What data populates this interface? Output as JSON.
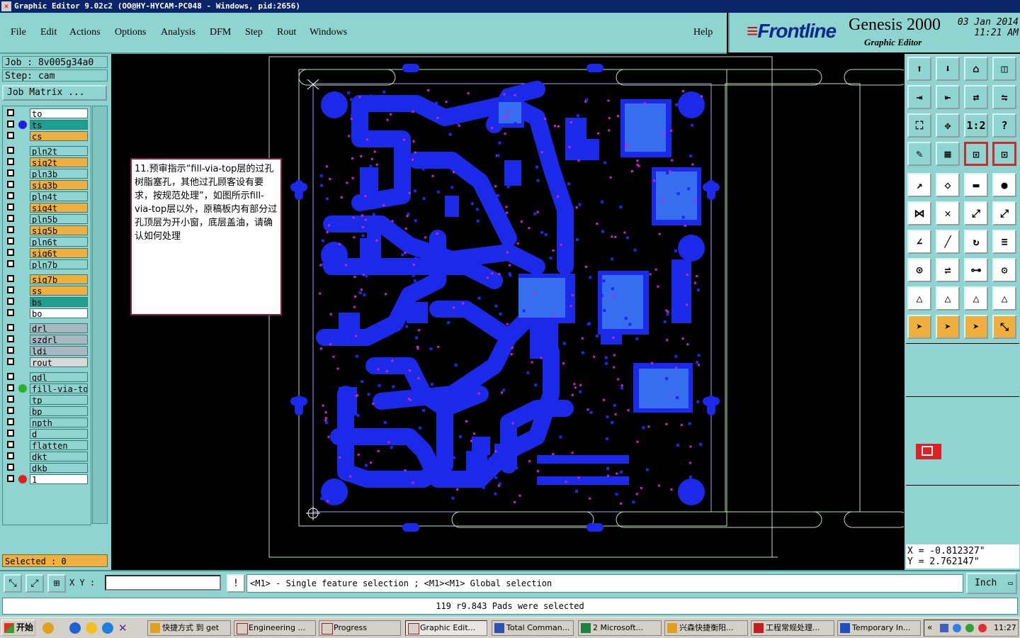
{
  "window": {
    "title": "Graphic Editor 9.02c2 (OO@HY-HYCAM-PC048 - Windows, pid:2656)"
  },
  "menu": {
    "items": [
      "File",
      "Edit",
      "Actions",
      "Options",
      "Analysis",
      "DFM",
      "Step",
      "Rout",
      "Windows"
    ],
    "help": "Help"
  },
  "brand": {
    "logo": "Frontline",
    "product": "Genesis 2000",
    "subtitle": "Graphic Editor",
    "date": "03 Jan 2014",
    "time": "11:21 AM"
  },
  "job": {
    "job_label": "Job : 8v005g34a0",
    "step_label": "Step: cam",
    "job_matrix_button": "Job Matrix ..."
  },
  "layers": [
    {
      "name": "to",
      "color": "#ffffff",
      "dot": ""
    },
    {
      "name": "ts",
      "color": "#1f9f8f",
      "dot": "#2020e0"
    },
    {
      "name": "cs",
      "color": "#f0b040",
      "dot": ""
    },
    {
      "name": "pln2t",
      "color": "#8fd4d0",
      "dot": ""
    },
    {
      "name": "sig2t",
      "color": "#f0b040",
      "dot": ""
    },
    {
      "name": "pln3b",
      "color": "#8fd4d0",
      "dot": ""
    },
    {
      "name": "sig3b",
      "color": "#f0b040",
      "dot": ""
    },
    {
      "name": "pln4t",
      "color": "#8fd4d0",
      "dot": ""
    },
    {
      "name": "sig4t",
      "color": "#f0b040",
      "dot": ""
    },
    {
      "name": "pln5b",
      "color": "#8fd4d0",
      "dot": ""
    },
    {
      "name": "sig5b",
      "color": "#f0b040",
      "dot": ""
    },
    {
      "name": "pln6t",
      "color": "#8fd4d0",
      "dot": ""
    },
    {
      "name": "sig6t",
      "color": "#f0b040",
      "dot": ""
    },
    {
      "name": "pln7b",
      "color": "#8fd4d0",
      "dot": ""
    },
    {
      "name": "sig7b",
      "color": "#f0b040",
      "dot": ""
    },
    {
      "name": "ss",
      "color": "#f0b040",
      "dot": ""
    },
    {
      "name": "bs",
      "color": "#1f9f8f",
      "dot": ""
    },
    {
      "name": "bo",
      "color": "#ffffff",
      "dot": ""
    },
    {
      "name": "drl",
      "color": "#a8b8c0",
      "dot": ""
    },
    {
      "name": "szdrl",
      "color": "#a8b8c0",
      "dot": ""
    },
    {
      "name": "ldi",
      "color": "#a8b8c0",
      "dot": ""
    },
    {
      "name": "rout",
      "color": "#d8d8d8",
      "dot": ""
    },
    {
      "name": "gdl",
      "color": "#8fd4d0",
      "dot": ""
    },
    {
      "name": "fill-via-top",
      "color": "#8fd4d0",
      "dot": "#30b030"
    },
    {
      "name": "tp",
      "color": "#8fd4d0",
      "dot": ""
    },
    {
      "name": "bp",
      "color": "#8fd4d0",
      "dot": ""
    },
    {
      "name": "npth",
      "color": "#8fd4d0",
      "dot": ""
    },
    {
      "name": "d",
      "color": "#8fd4d0",
      "dot": ""
    },
    {
      "name": "flatten",
      "color": "#8fd4d0",
      "dot": ""
    },
    {
      "name": "dkt",
      "color": "#8fd4d0",
      "dot": ""
    },
    {
      "name": "dkb",
      "color": "#8fd4d0",
      "dot": ""
    },
    {
      "name": "1",
      "color": "#ffffff",
      "dot": "#e02020"
    }
  ],
  "selected_label": "Selected : 0",
  "note": {
    "text": "11.预审指示“fill-via-top层的过孔树脂塞孔，其他过孔顾客设有要求，按规范处理”，如图所示fill-via-top层以外，原稿板内有部分过孔顶层为开小窗，底层盖油，请确认如何处理"
  },
  "coords": {
    "x": "X = -0.812327\"",
    "y": "Y = 2.762147\""
  },
  "command": {
    "xy_label": "X Y :",
    "xy_value": "",
    "hint": "<M1> - Single feature selection ; <M1><M1> Global selection",
    "units": "Inch"
  },
  "status_message": "119 r9.843 Pads were selected",
  "colors": {
    "panel": "#8fd4d0",
    "feature_blue": "#1a2ae8",
    "feature_light": "#3a6af0",
    "via_magenta": "#d020d8",
    "profile_green": "#b8e0b8"
  },
  "taskbar": {
    "start": "开始",
    "tasks": [
      "快捷方式 到 get",
      "Engineering ...",
      "Progress",
      "Graphic Edit...",
      "Total Comman...",
      "2 Microsoft...",
      "兴森快捷衡阳...",
      "工程常规处理...",
      "Temporary In..."
    ],
    "clock": "11:27"
  }
}
